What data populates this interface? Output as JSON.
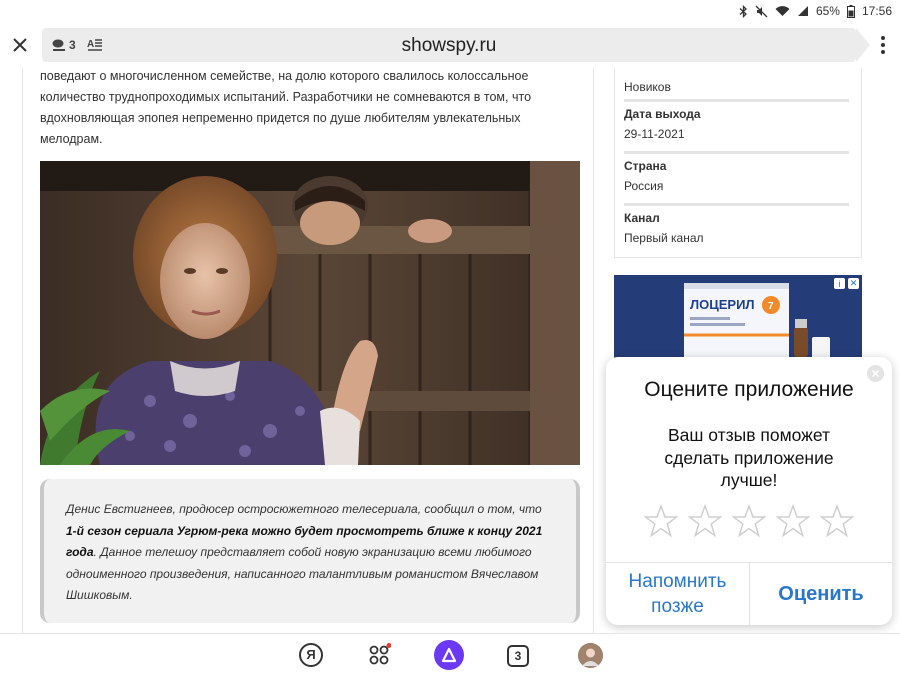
{
  "status": {
    "battery": "65%",
    "time": "17:56"
  },
  "toolbar": {
    "url": "showspy.ru",
    "tabs_count": "3"
  },
  "article": {
    "intro": "поведают о многочисленном семействе, на долю которого свалилось колоссальное количество труднопроходимых испытаний. Разработчики не сомневаются в том, что вдохновляющая эпопея непременно придется по душе любителям увлекательных мелодрам.",
    "quote_part1": "Денис Евстигнеев, продюсер остросюжетного телесериала, сообщил о том, что ",
    "quote_bold": "1-й сезон сериала Угрюм-река можно будет просмотреть ближе к концу 2021 года",
    "quote_part2": ". Данное телешоу представляет собой новую экранизацию всеми любимого одноименного произведения, написанного талантливым романистом Вячеславом Шишковым."
  },
  "info": {
    "director_value": "Новиков",
    "release_label": "Дата выхода",
    "release_value": "29-11-2021",
    "country_label": "Страна",
    "country_value": "Россия",
    "channel_label": "Канал",
    "channel_value": "Первый канал"
  },
  "ad": {
    "brand": "ЛОЦЕРИЛ"
  },
  "rating_modal": {
    "title": "Оцените приложение",
    "text": "Ваш отзыв поможет сделать приложение лучше!",
    "later_button": "Напомнить позже",
    "rate_button": "Оценить",
    "stars": 5
  },
  "bottom_nav": {
    "yandex_label": "Я",
    "tabs_count": "3"
  },
  "colors": {
    "accent": "#2878c8",
    "alice": "#6b39f5",
    "ad_bg": "#243c77"
  }
}
